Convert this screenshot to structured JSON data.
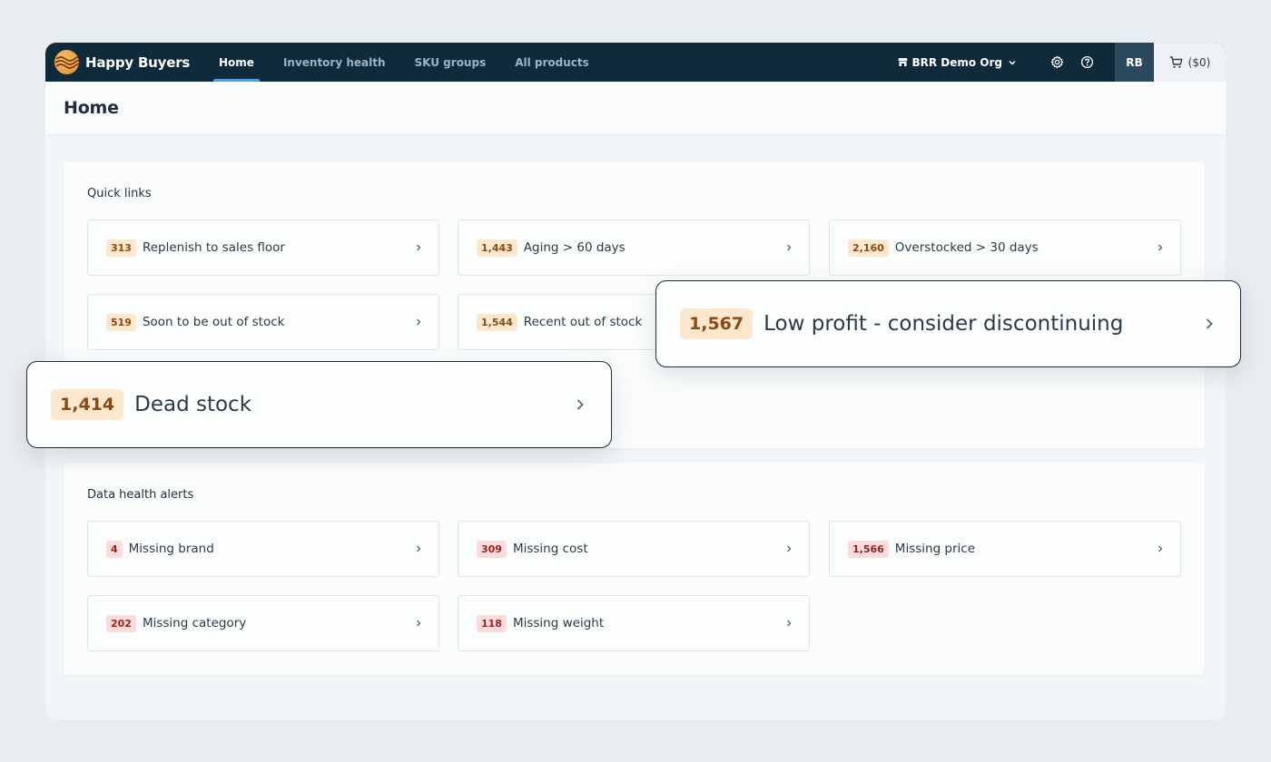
{
  "nav": {
    "brand": "Happy Buyers",
    "links": [
      "Home",
      "Inventory health",
      "SKU groups",
      "All products"
    ],
    "org": "BRR Demo Org",
    "avatar": "RB",
    "cart": "($0)"
  },
  "page": {
    "title": "Home"
  },
  "quick_links": {
    "title": "Quick links",
    "items": [
      {
        "count": "313",
        "label": "Replenish to sales floor"
      },
      {
        "count": "1,443",
        "label": "Aging > 60 days"
      },
      {
        "count": "2,160",
        "label": "Overstocked > 30 days"
      },
      {
        "count": "519",
        "label": "Soon to be out of stock"
      },
      {
        "count": "1,544",
        "label": "Recent out of stock"
      }
    ],
    "callouts": [
      {
        "count": "1,567",
        "label": "Low profit - consider discontinuing"
      },
      {
        "count": "1,414",
        "label": "Dead stock"
      }
    ]
  },
  "data_health": {
    "title": "Data health alerts",
    "items": [
      {
        "count": "4",
        "label": "Missing brand"
      },
      {
        "count": "309",
        "label": "Missing cost"
      },
      {
        "count": "1,566",
        "label": "Missing price"
      },
      {
        "count": "202",
        "label": "Missing category"
      },
      {
        "count": "118",
        "label": "Missing weight"
      }
    ]
  },
  "colors": {
    "nav_bg": "#0f2a3a",
    "accent": "#3fa4e8",
    "badge_orange_bg": "#fde7cf",
    "badge_red_bg": "#fbdcdc"
  }
}
